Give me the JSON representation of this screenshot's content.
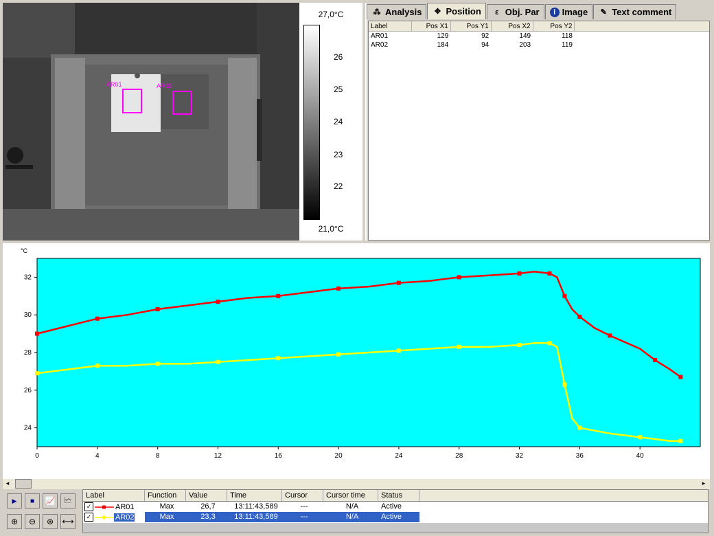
{
  "scale": {
    "top_label": "27,0°C",
    "bottom_label": "21,0°C",
    "ticks": [
      "26",
      "25",
      "24",
      "23",
      "22"
    ]
  },
  "thermal": {
    "roi": [
      {
        "label": "AR01",
        "color": "#ff00ff"
      },
      {
        "label": "AR02",
        "color": "#ff00ff"
      }
    ]
  },
  "tabs": [
    {
      "label": "Analysis",
      "icon": "analysis-icon",
      "active": false
    },
    {
      "label": "Position",
      "icon": "position-icon",
      "active": true
    },
    {
      "label": "Obj. Par",
      "icon": "object-parameter-icon",
      "active": false
    },
    {
      "label": "Image",
      "icon": "info-icon",
      "active": false
    },
    {
      "label": "Text comment",
      "icon": "text-comment-icon",
      "active": false
    }
  ],
  "position_table": {
    "headers": [
      "Label",
      "Pos X1",
      "Pos Y1",
      "Pos X2",
      "Pos Y2"
    ],
    "rows": [
      [
        "AR01",
        "129",
        "92",
        "149",
        "118"
      ],
      [
        "AR02",
        "184",
        "94",
        "203",
        "119"
      ]
    ]
  },
  "colors": {
    "plot_bg": "#00ffff",
    "series_ar01": "#ff0000",
    "series_ar02": "#ffff00",
    "selection": "#3163c6"
  },
  "chart_data": {
    "type": "line",
    "ylabel": "°C",
    "xlim": [
      0,
      44
    ],
    "ylim": [
      23,
      33
    ],
    "xticks": [
      0,
      4,
      8,
      12,
      16,
      20,
      24,
      28,
      32,
      36,
      40
    ],
    "yticks": [
      24,
      26,
      28,
      30,
      32
    ],
    "grid": false,
    "series": [
      {
        "name": "AR01",
        "color": "#ff0000",
        "points": [
          [
            0,
            29.0
          ],
          [
            2,
            29.4
          ],
          [
            4,
            29.8
          ],
          [
            6,
            30.0
          ],
          [
            8,
            30.3
          ],
          [
            10,
            30.5
          ],
          [
            12,
            30.7
          ],
          [
            14,
            30.9
          ],
          [
            16,
            31.0
          ],
          [
            18,
            31.2
          ],
          [
            20,
            31.4
          ],
          [
            22,
            31.5
          ],
          [
            24,
            31.7
          ],
          [
            26,
            31.8
          ],
          [
            28,
            32.0
          ],
          [
            30,
            32.1
          ],
          [
            32,
            32.2
          ],
          [
            33,
            32.3
          ],
          [
            34,
            32.2
          ],
          [
            34.5,
            32.0
          ],
          [
            35,
            31.0
          ],
          [
            35.5,
            30.3
          ],
          [
            36,
            29.9
          ],
          [
            37,
            29.3
          ],
          [
            38,
            28.9
          ],
          [
            40,
            28.2
          ],
          [
            41,
            27.6
          ],
          [
            42,
            27.1
          ],
          [
            42.7,
            26.7
          ]
        ]
      },
      {
        "name": "AR02",
        "color": "#ffff00",
        "points": [
          [
            0,
            26.9
          ],
          [
            2,
            27.1
          ],
          [
            4,
            27.3
          ],
          [
            6,
            27.3
          ],
          [
            8,
            27.4
          ],
          [
            10,
            27.4
          ],
          [
            12,
            27.5
          ],
          [
            14,
            27.6
          ],
          [
            16,
            27.7
          ],
          [
            18,
            27.8
          ],
          [
            20,
            27.9
          ],
          [
            22,
            28.0
          ],
          [
            24,
            28.1
          ],
          [
            26,
            28.2
          ],
          [
            28,
            28.3
          ],
          [
            30,
            28.3
          ],
          [
            32,
            28.4
          ],
          [
            33,
            28.5
          ],
          [
            34,
            28.5
          ],
          [
            34.5,
            28.3
          ],
          [
            35,
            26.3
          ],
          [
            35.5,
            24.5
          ],
          [
            36,
            24.0
          ],
          [
            38,
            23.7
          ],
          [
            40,
            23.5
          ],
          [
            42,
            23.3
          ],
          [
            42.7,
            23.3
          ]
        ]
      }
    ]
  },
  "legend_list": {
    "headers": [
      "Label",
      "Function",
      "Value",
      "Time",
      "Cursor",
      "Cursor time",
      "Status"
    ],
    "rows": [
      {
        "label": "AR01",
        "function": "Max",
        "value": "26,7",
        "time": "13:11:43,589",
        "cursor": "---",
        "cursor_time": "N/A",
        "status": "Active",
        "color": "#ff0000",
        "selected": false
      },
      {
        "label": "AR02",
        "function": "Max",
        "value": "23,3",
        "time": "13:11:43,589",
        "cursor": "---",
        "cursor_time": "N/A",
        "status": "Active",
        "color": "#ffff00",
        "selected": true
      }
    ]
  }
}
